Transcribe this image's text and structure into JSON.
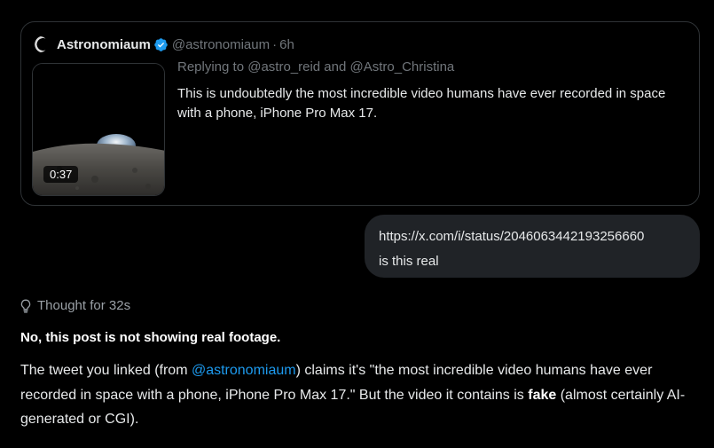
{
  "quoted_tweet": {
    "display_name": "Astronomiaum",
    "handle": "@astronomiaum",
    "separator": "·",
    "time": "6h",
    "verified": true,
    "replying_to": "Replying to @astro_reid and @Astro_Christina",
    "text": "This is undoubtedly the most incredible video humans have ever recorded in space with a phone, iPhone Pro Max 17.",
    "video_duration": "0:37",
    "avatar_icon": "crescent-moon-icon",
    "verified_color": "#1d9bf0"
  },
  "user_message": {
    "url": "https://x.com/i/status/2046063442193256660",
    "question": "is this real"
  },
  "assistant_reply": {
    "thought_label": "Thought for 32s",
    "headline": "No, this post is not showing real footage.",
    "body_part1": "The tweet you linked (from ",
    "mention": "@astronomiaum",
    "body_part2": ") claims it's \"the most incredible video humans have ever recorded in space with a phone, iPhone Pro Max 17.\" But the video it contains is ",
    "emphasis": "fake",
    "body_part3": " (almost certainly AI-generated or CGI)."
  },
  "colors": {
    "background": "#000000",
    "bubble": "#202327",
    "border": "#2f3336",
    "muted": "#71767b",
    "link": "#1d9bf0"
  }
}
